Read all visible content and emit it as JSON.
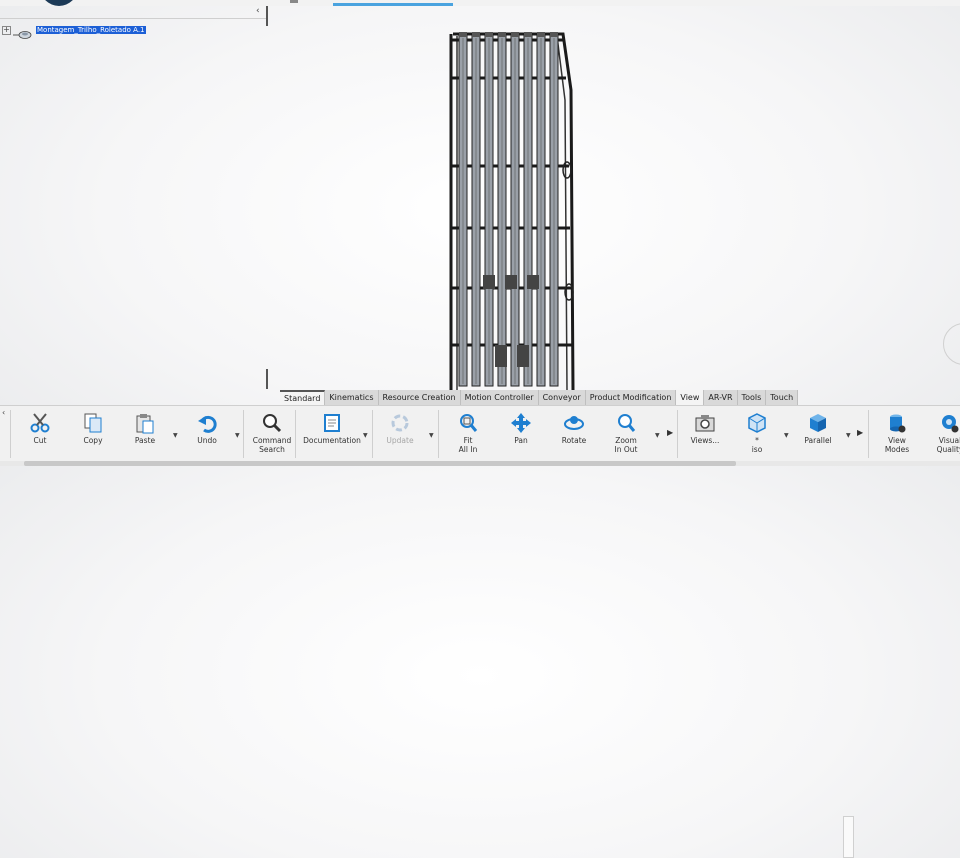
{
  "window": {
    "title": ""
  },
  "tree": {
    "collapse_label": "‹",
    "root": {
      "expander": "+",
      "label": "Montagem_Trilho_Roletado A.1"
    }
  },
  "tabs": [
    {
      "label": "Standard",
      "active": true
    },
    {
      "label": "Kinematics"
    },
    {
      "label": "Resource Creation"
    },
    {
      "label": "Motion Controller"
    },
    {
      "label": "Conveyor"
    },
    {
      "label": "Product Modification"
    },
    {
      "label": "View",
      "current": true
    },
    {
      "label": "AR-VR"
    },
    {
      "label": "Tools"
    },
    {
      "label": "Touch"
    }
  ],
  "ribbon": {
    "cut": {
      "label": "Cut",
      "icon": "scissors-icon"
    },
    "copy": {
      "label": "Copy",
      "icon": "copy-icon"
    },
    "paste": {
      "label": "Paste",
      "icon": "paste-icon"
    },
    "undo": {
      "label": "Undo",
      "icon": "undo-icon"
    },
    "command_search": {
      "label_1": "Command",
      "label_2": "Search",
      "icon": "magnifier-icon"
    },
    "documentation": {
      "label": "Documentation",
      "icon": "book-icon"
    },
    "update": {
      "label": "Update",
      "icon": "update-icon"
    },
    "fit_all_in": {
      "label_1": "Fit",
      "label_2": "All In",
      "icon": "fit-all-icon"
    },
    "pan": {
      "label": "Pan",
      "icon": "pan-icon"
    },
    "rotate": {
      "label": "Rotate",
      "icon": "rotate-icon"
    },
    "zoom": {
      "label_1": "Zoom",
      "label_2": "In Out",
      "icon": "zoom-icon"
    },
    "views": {
      "label": "Views...",
      "icon": "camera-icon"
    },
    "iso": {
      "label_1": "*",
      "label_2": "iso",
      "icon": "iso-view-icon"
    },
    "parallel": {
      "label": "Parallel",
      "icon": "cube-icon"
    },
    "view_modes": {
      "label_1": "View",
      "label_2": "Modes",
      "icon": "view-modes-icon"
    },
    "visual_quality": {
      "label_1": "Visual",
      "label_2": "Quality",
      "icon": "visual-quality-icon"
    }
  },
  "colors": {
    "selection": "#1c5fd6",
    "accent": "#4aa3df",
    "icon_blue": "#1f7fd0"
  }
}
